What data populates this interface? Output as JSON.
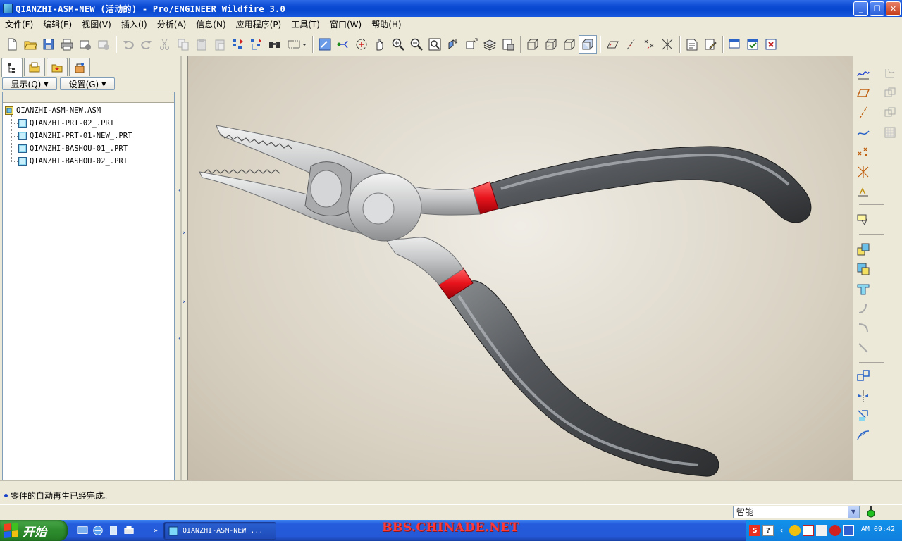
{
  "window": {
    "title": "QIANZHI-ASM-NEW (活动的) - Pro/ENGINEER Wildfire 3.0",
    "min_label": "_",
    "max_label": "❐",
    "close_label": "✕"
  },
  "menu": [
    {
      "label": "文件(F)"
    },
    {
      "label": "编辑(E)"
    },
    {
      "label": "视图(V)"
    },
    {
      "label": "插入(I)"
    },
    {
      "label": "分析(A)"
    },
    {
      "label": "信息(N)"
    },
    {
      "label": "应用程序(P)"
    },
    {
      "label": "工具(T)"
    },
    {
      "label": "窗口(W)"
    },
    {
      "label": "帮助(H)"
    }
  ],
  "panel": {
    "show_label": "显示(Q)",
    "settings_label": "设置(G)",
    "tree": [
      {
        "label": "QIANZHI-ASM-NEW.ASM",
        "type": "assembly"
      },
      {
        "label": "QIANZHI-PRT-02_.PRT",
        "type": "part"
      },
      {
        "label": "QIANZHI-PRT-01-NEW_.PRT",
        "type": "part"
      },
      {
        "label": "QIANZHI-BASHOU-01_.PRT",
        "type": "part"
      },
      {
        "label": "QIANZHI-BASHOU-02_.PRT",
        "type": "part"
      }
    ]
  },
  "status": {
    "message": "零件的自动再生已经完成。",
    "filter_value": "智能"
  },
  "taskbar": {
    "start_label": "开始",
    "task_label": "QIANZHI-ASM-NEW ...",
    "watermark": "BBS.CHINADE.NET",
    "clock": "AM 09:42"
  },
  "colors": {
    "accent_red": "#e8141c",
    "handle_gray": "#55585c",
    "steel": "#c8c9ca"
  }
}
